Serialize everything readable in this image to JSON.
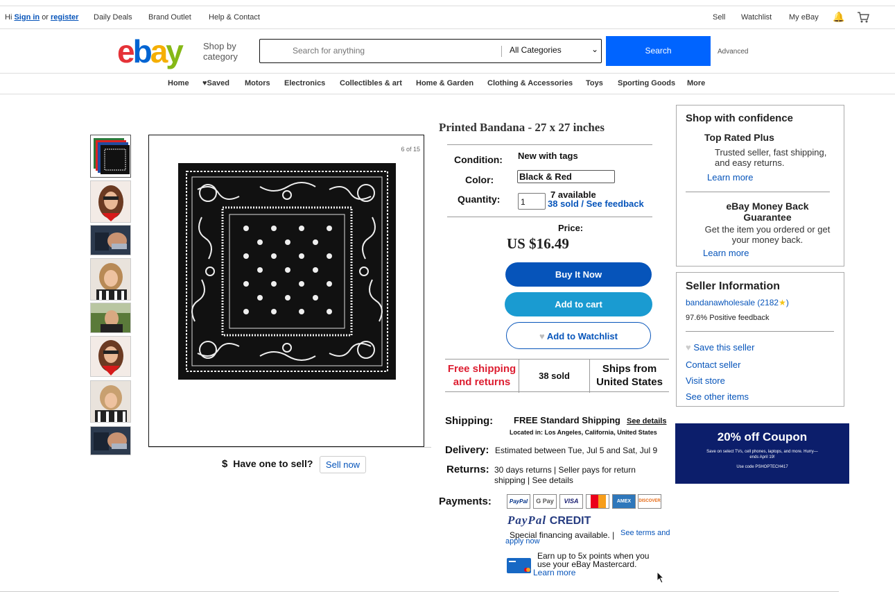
{
  "topbar": {
    "hi": "Hi",
    "sign_in": "Sign in",
    "or": "or",
    "register": "register",
    "daily_deals": "Daily Deals",
    "brand_outlet": "Brand Outlet",
    "help": "Help & Contact",
    "sell": "Sell",
    "watchlist": "Watchlist",
    "my_ebay": "My eBay"
  },
  "header": {
    "shop_by": "Shop by category",
    "search_placeholder": "Search for anything",
    "category": "All Categories",
    "search_button": "Search",
    "advanced": "Advanced"
  },
  "nav": [
    "Home",
    "♥Saved",
    "Motors",
    "Electronics",
    "Collectibles & art",
    "Home & Garden",
    "Clothing & Accessories",
    "Toys",
    "Sporting Goods",
    "More"
  ],
  "gallery": {
    "counter": "6 of 15",
    "have_one": "Have one to sell?",
    "sell_now": "Sell now"
  },
  "item": {
    "title": "Printed Bandana - 27 x 27 inches",
    "condition_label": "Condition:",
    "condition": "New with tags",
    "color_label": "Color:",
    "color": "Black & Red",
    "quantity_label": "Quantity:",
    "quantity": "1",
    "available": "7 available",
    "sold_feedback": "38 sold / See feedback",
    "price_label": "Price:",
    "price": "US $16.49",
    "buy_now": "Buy It Now",
    "add_to_cart": "Add to cart",
    "add_watchlist": "Add to Watchlist"
  },
  "highlights": {
    "free_shipping": "Free shipping and returns",
    "sold": "38 sold",
    "ships_from": "Ships from United States"
  },
  "shipping": {
    "label": "Shipping:",
    "value": "FREE Standard Shipping",
    "see_details": "See details",
    "location": "Located in: Los Angeles, California, United States",
    "delivery_label": "Delivery:",
    "delivery": "Estimated between Tue, Jul 5 and Sat, Jul 9",
    "returns_label": "Returns:",
    "returns": "30 days returns | Seller pays for return shipping | See details",
    "payments_label": "Payments:",
    "badges": [
      "PayPal",
      "G Pay",
      "VISA",
      "MC",
      "AMEX",
      "DISCOVER"
    ],
    "paypal_credit_a": "PayPal",
    "paypal_credit_b": "CREDIT",
    "financing": "Special financing available. |",
    "see_terms": "See terms and apply now",
    "mastercard": "Earn up to 5x points when you use your eBay Mastercard.",
    "learn_more": "Learn more"
  },
  "confidence": {
    "title": "Shop with confidence",
    "trp_title": "Top Rated Plus",
    "trp_desc": "Trusted seller, fast shipping, and easy returns.",
    "learn_more": "Learn more",
    "mbg_title": "eBay Money Back Guarantee",
    "mbg_desc": "Get the item you ordered or get your money back.",
    "learn_more2": "Learn more"
  },
  "seller": {
    "title": "Seller Information",
    "name": "bandanawholesale (2182",
    "feedback": "97.6% Positive feedback",
    "save": "Save this seller",
    "contact": "Contact seller",
    "visit": "Visit store",
    "other": "See other items"
  },
  "ad": {
    "headline": "20% off Coupon",
    "body": "Save on select TVs, cell phones, laptops, and more. Hurry—ends April 19!",
    "code": "Use code PSHOPTECH417"
  },
  "colors": {
    "brand_blue": "#0064d2",
    "buy_now": "#0654ba",
    "add_cart": "#1a9bd1",
    "free_shipping": "#dd1e31"
  }
}
